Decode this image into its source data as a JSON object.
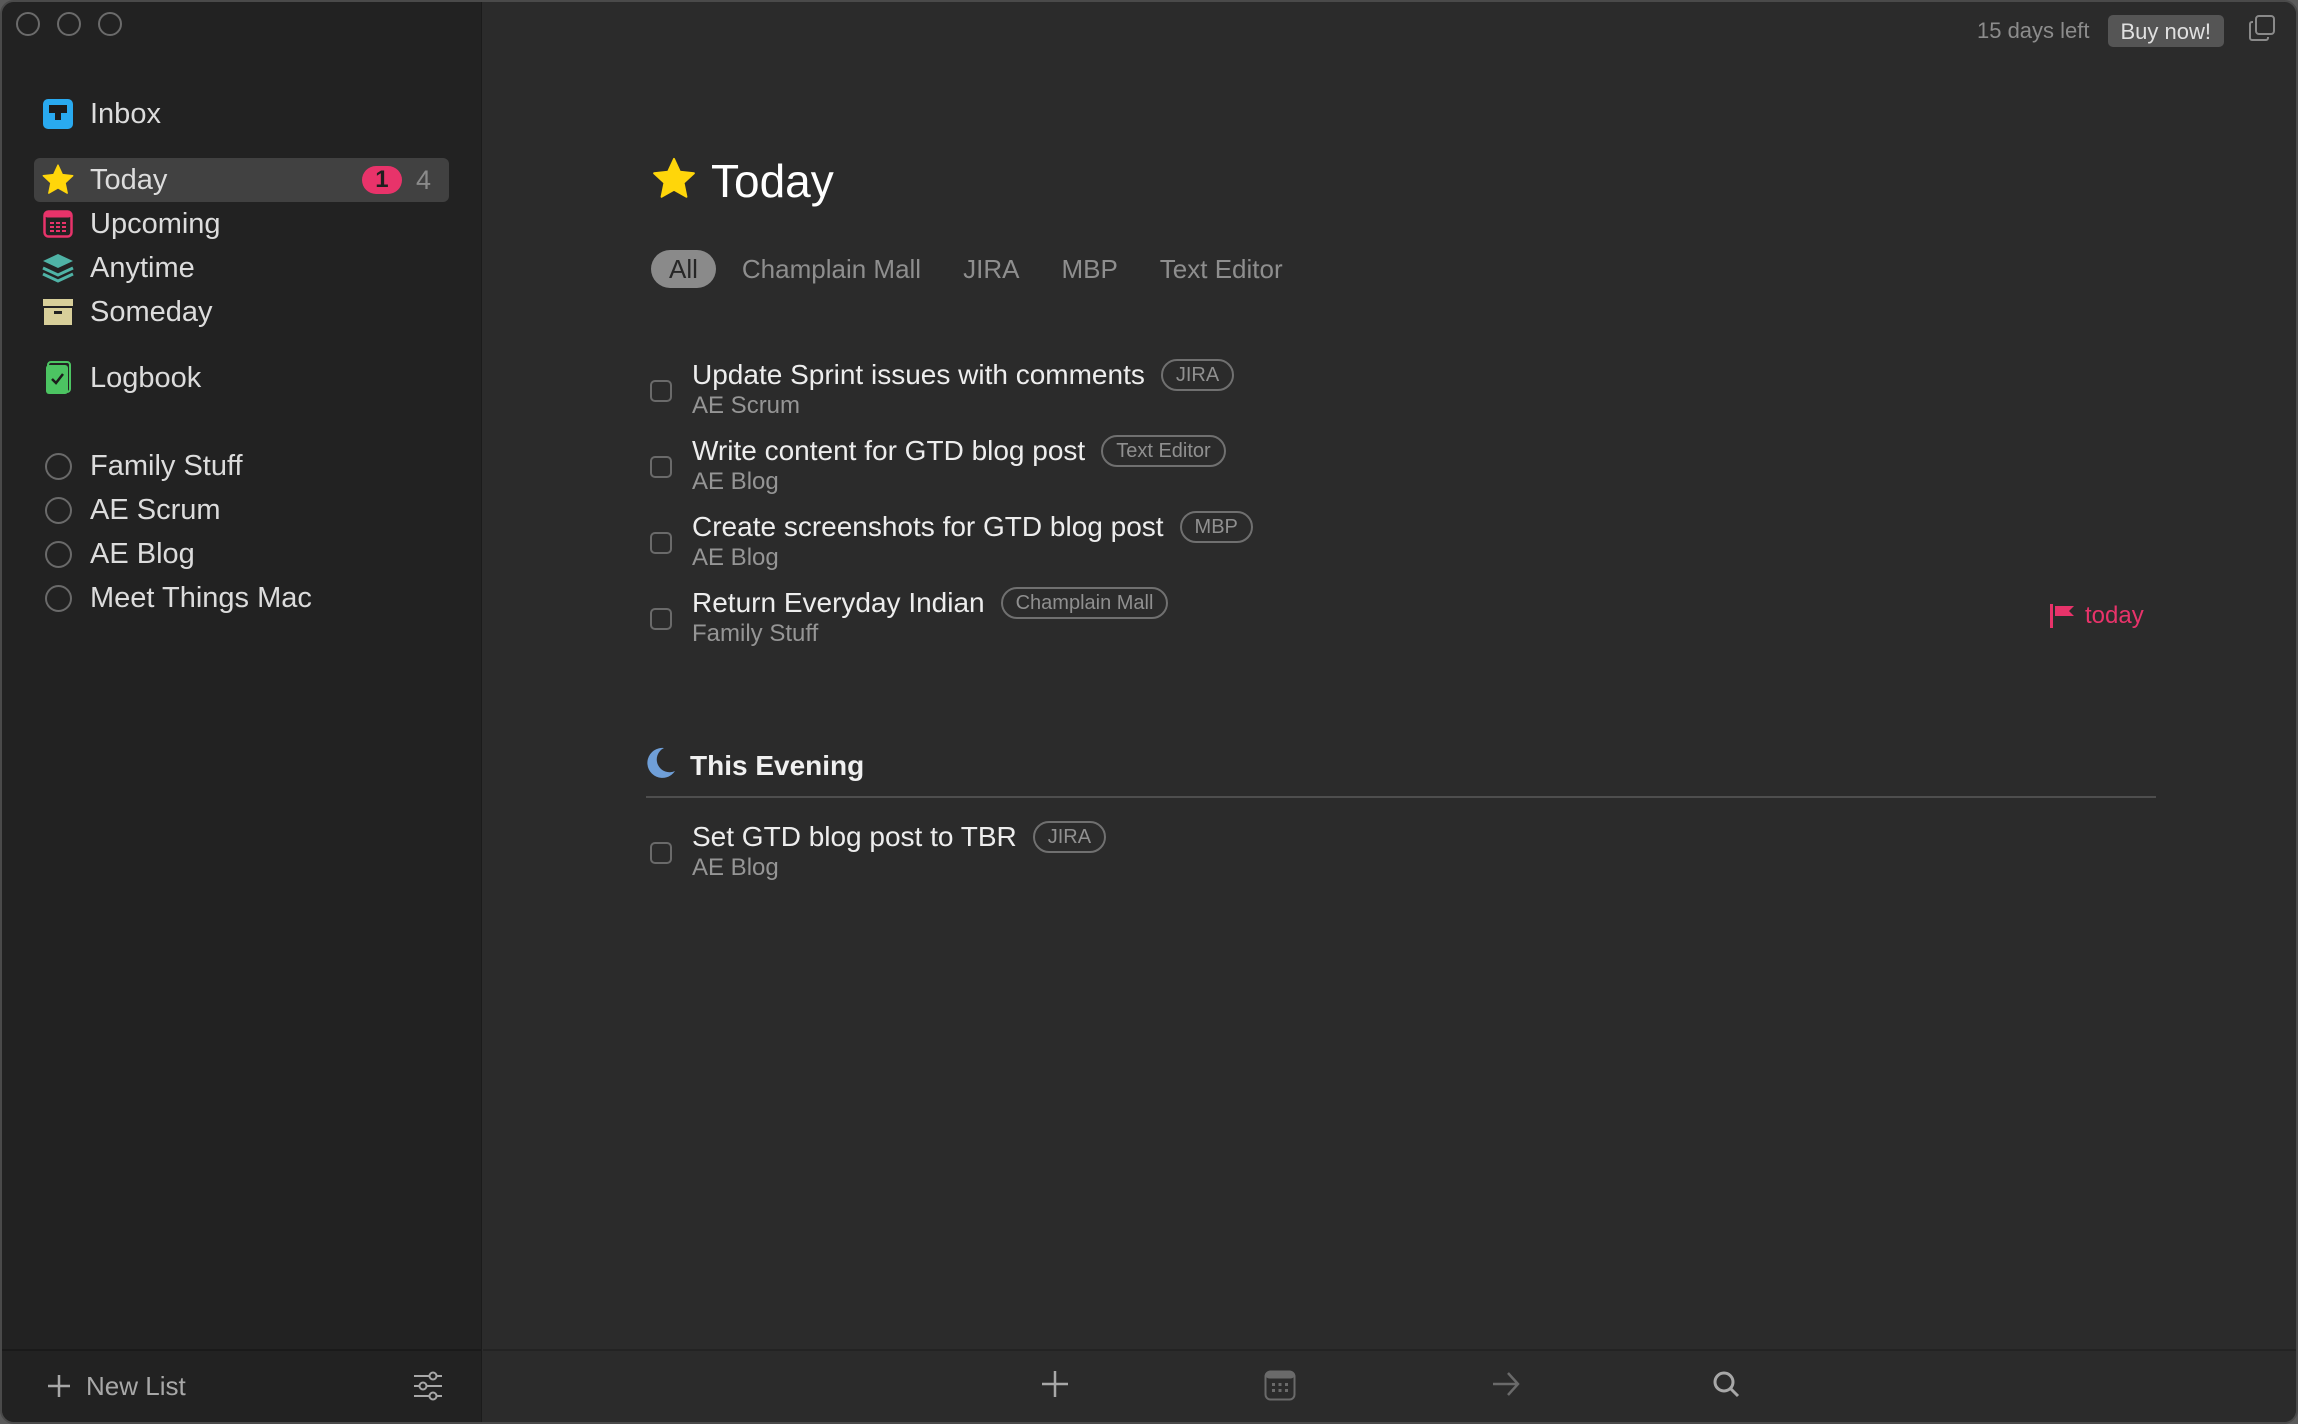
{
  "window": {
    "trial_text": "15 days left",
    "buy_label": "Buy now!"
  },
  "sidebar": {
    "inbox": {
      "label": "Inbox",
      "icon": "inbox-icon"
    },
    "nav": [
      {
        "label": "Today",
        "icon": "star-icon",
        "badge": "1",
        "count": "4",
        "active": true
      },
      {
        "label": "Upcoming",
        "icon": "calendar-icon"
      },
      {
        "label": "Anytime",
        "icon": "layers-icon"
      },
      {
        "label": "Someday",
        "icon": "archive-box-icon"
      }
    ],
    "logbook": {
      "label": "Logbook",
      "icon": "logbook-icon"
    },
    "projects": [
      {
        "label": "Family Stuff"
      },
      {
        "label": "AE Scrum"
      },
      {
        "label": "AE Blog"
      },
      {
        "label": "Meet Things Mac"
      }
    ],
    "footer": {
      "new_list_label": "New List"
    }
  },
  "main": {
    "title": "Today",
    "tabs": [
      {
        "label": "All",
        "active": true
      },
      {
        "label": "Champlain Mall"
      },
      {
        "label": "JIRA"
      },
      {
        "label": "MBP"
      },
      {
        "label": "Text Editor"
      }
    ],
    "tasks": [
      {
        "title": "Update Sprint issues with comments",
        "tag": "JIRA",
        "project": "AE Scrum"
      },
      {
        "title": "Write content for GTD blog post",
        "tag": "Text Editor",
        "project": "AE Blog"
      },
      {
        "title": "Create screenshots for GTD blog post",
        "tag": "MBP",
        "project": "AE Blog"
      },
      {
        "title": "Return Everyday Indian",
        "tag": "Champlain Mall",
        "project": "Family Stuff",
        "deadline": "today"
      }
    ],
    "evening": {
      "heading": "This Evening",
      "tasks": [
        {
          "title": "Set GTD blog post to TBR",
          "tag": "JIRA",
          "project": "AE Blog"
        }
      ]
    }
  },
  "toolbar": {
    "buttons": [
      "add-icon",
      "calendar-icon",
      "move-arrow-icon",
      "search-icon"
    ]
  },
  "colors": {
    "accent_red": "#e8336a",
    "inbox_blue": "#29aaf0",
    "star_yellow": "#ffd60a",
    "anytime_teal": "#4fb3a6",
    "someday_beige": "#d8cf9a",
    "logbook_green": "#4cc462",
    "evening_blue": "#6f9fd8"
  }
}
